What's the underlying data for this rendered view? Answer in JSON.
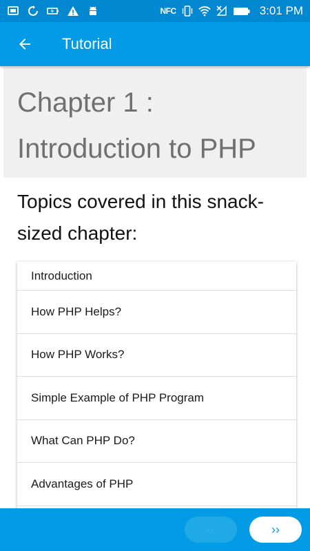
{
  "status_bar": {
    "time": "3:01 PM",
    "nfc": "NFC",
    "icons_left": [
      "screen-mirror-icon",
      "sync-icon",
      "battery-saver-icon",
      "warning-icon",
      "android-debug-icon"
    ],
    "icons_right": [
      "nfc-icon",
      "vibrate-icon",
      "wifi-icon",
      "no-signal-icon",
      "battery-icon"
    ]
  },
  "app_bar": {
    "title": "Tutorial",
    "back_icon": "arrow-back-icon"
  },
  "chapter": {
    "title_line1": "Chapter 1 :",
    "title_line2": "Introduction to PHP"
  },
  "topics": {
    "heading": "Topics covered in this snack-sized chapter:",
    "items": [
      "Introduction",
      "How PHP Helps?",
      "How PHP Works?",
      "Simple Example of PHP Program",
      "What Can PHP Do?",
      "Advantages of PHP"
    ]
  },
  "bottom_nav": {
    "prev_label": "‹‹",
    "next_label": "››"
  },
  "colors": {
    "status_bar": "#0288d1",
    "app_bar": "#039be5",
    "header_bg": "#f0f0f0",
    "header_text": "#707070"
  }
}
